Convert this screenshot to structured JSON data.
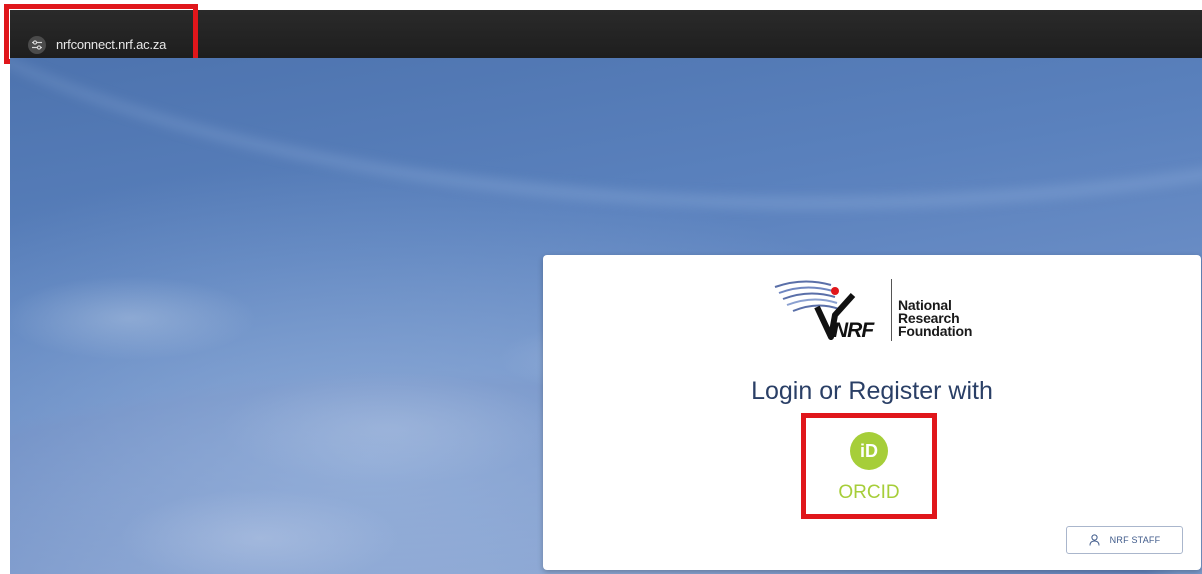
{
  "browser": {
    "url": "nrfconnect.nrf.ac.za",
    "site_icon": "tune-icon"
  },
  "login_card": {
    "logo": {
      "abbreviation": "NRF",
      "words": [
        "National",
        "Research",
        "Foundation"
      ]
    },
    "heading": "Login or Register with",
    "orcid": {
      "icon_text": "iD",
      "label": "ORCID",
      "color": "#a6ce39"
    },
    "staff_button": {
      "label": "NRF STAFF",
      "icon": "user-icon"
    }
  },
  "colors": {
    "highlight": "#e0161b",
    "heading": "#2a3f66"
  }
}
